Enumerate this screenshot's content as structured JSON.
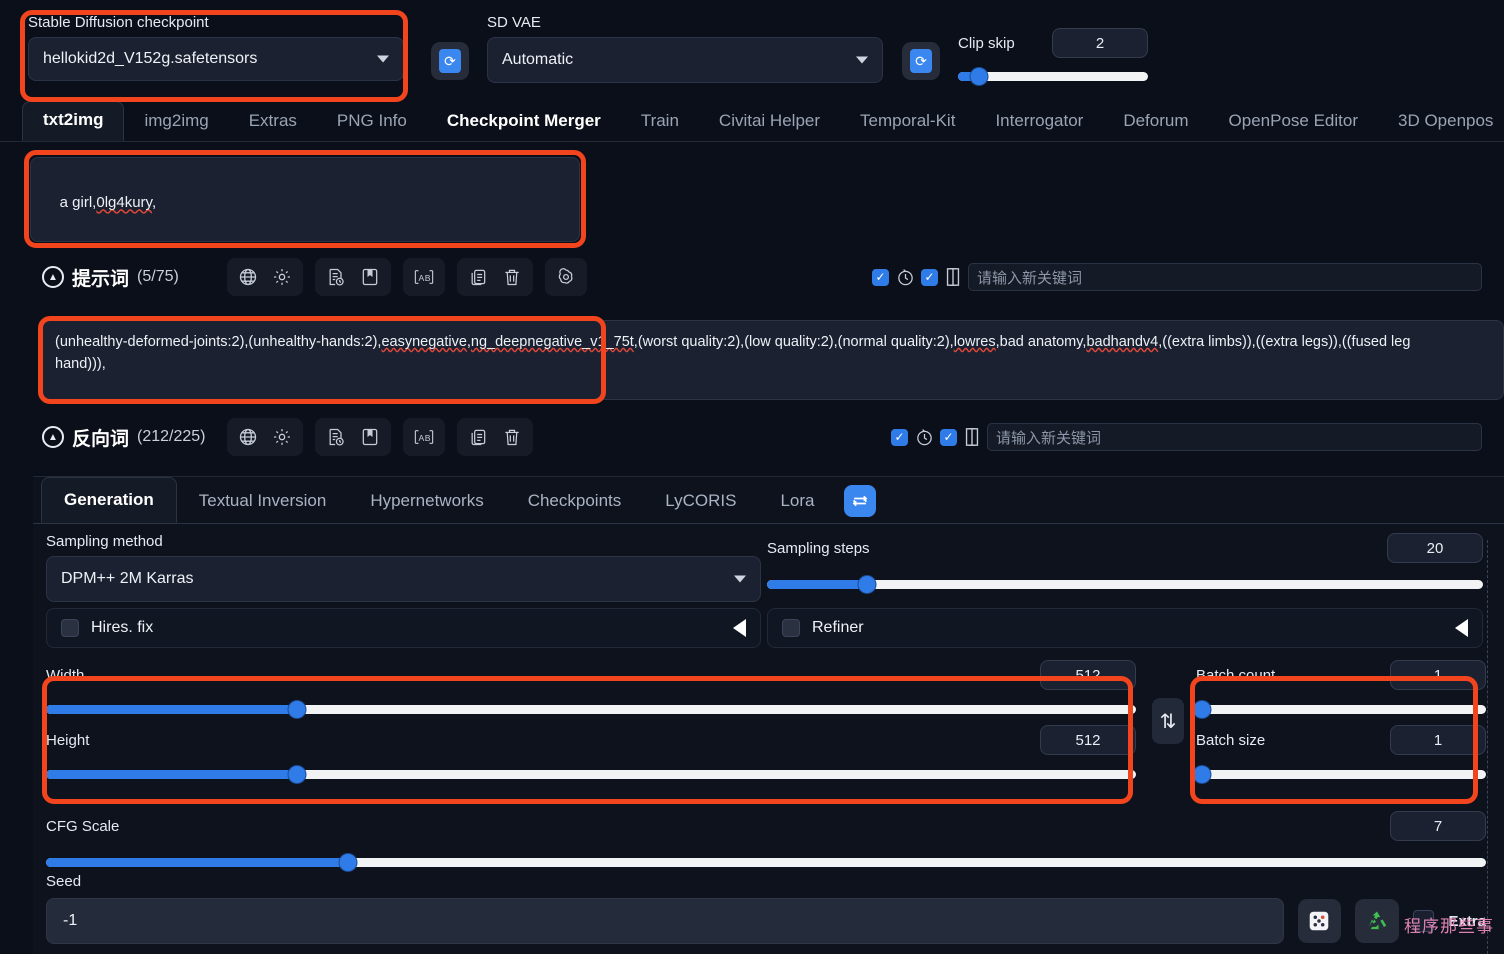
{
  "top": {
    "checkpoint_label": "Stable Diffusion checkpoint",
    "checkpoint_value": "hellokid2d_V152g.safetensors",
    "vae_label": "SD VAE",
    "vae_value": "Automatic",
    "clip_skip_label": "Clip skip",
    "clip_skip_value": "2",
    "clip_skip_pct": 11,
    "refresh_glyph": "⟳"
  },
  "tabs": [
    {
      "label": "txt2img",
      "state": "active"
    },
    {
      "label": "img2img",
      "state": "normal"
    },
    {
      "label": "Extras",
      "state": "normal"
    },
    {
      "label": "PNG Info",
      "state": "normal"
    },
    {
      "label": "Checkpoint Merger",
      "state": "bright"
    },
    {
      "label": "Train",
      "state": "normal"
    },
    {
      "label": "Civitai Helper",
      "state": "normal"
    },
    {
      "label": "Temporal-Kit",
      "state": "normal"
    },
    {
      "label": "Interrogator",
      "state": "normal"
    },
    {
      "label": "Deforum",
      "state": "normal"
    },
    {
      "label": "OpenPose Editor",
      "state": "normal"
    },
    {
      "label": "3D Openpos",
      "state": "normal"
    }
  ],
  "prompt": {
    "text_plain": "a girl,",
    "text_spell": "0lg4kury",
    "text_tail": ",",
    "title": "提示词",
    "count": "(5/75)",
    "keyword_placeholder": "请输入新关键词",
    "icons": [
      "globe-icon",
      "gear-icon",
      "doc-clock-icon",
      "bookmark-icon",
      "translate-ab-icon",
      "copy-icon",
      "trash-icon",
      "openai-spiral-icon"
    ]
  },
  "negative": {
    "line1_a": "(unhealthy-deformed-joints:2),(unhealthy-hands:2),",
    "line1_spell1": "easynegative",
    "line1_b": ",",
    "line1_spell2": "ng_deepnegative_v1_75t",
    "line1_c": ",(worst quality:2),(low quality:2),(normal quality:2),",
    "line1_spell3": "lowres",
    "line1_d": ",bad anatomy,",
    "line1_spell4": "badhandv4",
    "line1_e": ",((extra limbs)),((extra legs)),((fused leg",
    "line2": "hand))),",
    "title": "反向词",
    "count": "(212/225)",
    "keyword_placeholder": "请输入新关键词",
    "icons": [
      "globe-icon",
      "gear-icon",
      "doc-clock-icon",
      "bookmark-icon",
      "translate-ab-icon",
      "copy-icon",
      "trash-icon"
    ]
  },
  "panel_tabs": [
    {
      "label": "Generation",
      "active": true
    },
    {
      "label": "Textual Inversion",
      "active": false
    },
    {
      "label": "Hypernetworks",
      "active": false
    },
    {
      "label": "Checkpoints",
      "active": false
    },
    {
      "label": "LyCORIS",
      "active": false
    },
    {
      "label": "Lora",
      "active": false
    }
  ],
  "panel_refresh_icon": "refresh-networks-icon",
  "generation": {
    "sampling_method_label": "Sampling method",
    "sampling_method_value": "DPM++ 2M Karras",
    "sampling_steps_label": "Sampling steps",
    "sampling_steps_value": "20",
    "sampling_steps_pct": 14,
    "hires_label": "Hires. fix",
    "refiner_label": "Refiner",
    "width_label": "Width",
    "width_value": "512",
    "width_pct": 23,
    "height_label": "Height",
    "height_value": "512",
    "height_pct": 23,
    "swap_glyph": "⇅",
    "batch_count_label": "Batch count",
    "batch_count_value": "1",
    "batch_count_pct": 1,
    "batch_size_label": "Batch size",
    "batch_size_value": "1",
    "batch_size_pct": 1,
    "cfg_label": "CFG Scale",
    "cfg_value": "7",
    "cfg_pct": 21,
    "seed_label": "Seed",
    "seed_value": "-1",
    "dice_glyph": "⚅",
    "recycle_glyph": "♻",
    "extra_label": "Extra"
  },
  "watermark": "程序那些事",
  "colors": {
    "accent_blue": "#2f7ce8",
    "annotation_red": "#f2441d",
    "panel_bg": "#0b0f19",
    "input_bg": "#1b2130",
    "watermark_pink": "#e887b8"
  }
}
